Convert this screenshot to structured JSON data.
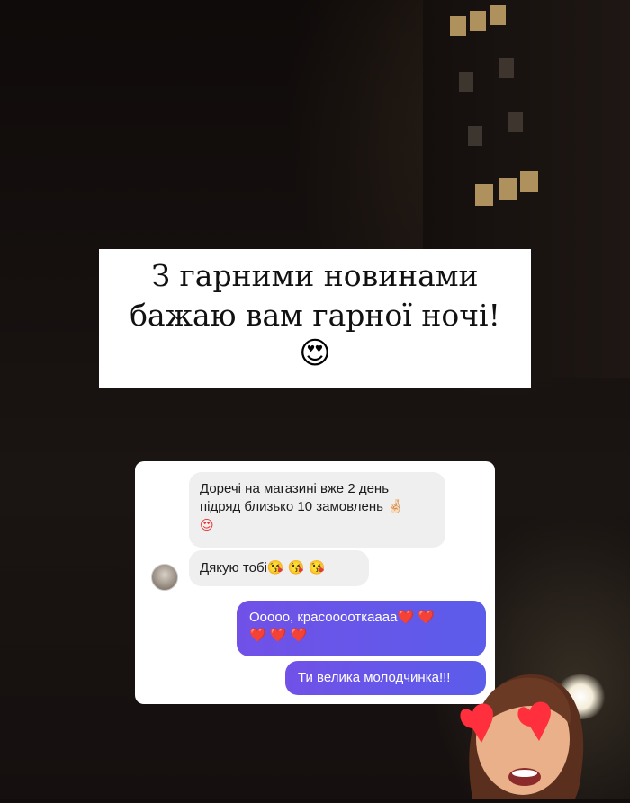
{
  "headline": {
    "line1": "З гарними новинами",
    "line2": "бажаю вам гарної ночі!",
    "emoji": "😍"
  },
  "chat": {
    "messages": [
      {
        "side": "in",
        "line1": "Доречі на магазині вже 2 день",
        "line2": "підряд близько 10 замовлень 🤞🏻",
        "line3": "😍"
      },
      {
        "side": "in",
        "text": "Дякую тобі😘 😘 😘"
      },
      {
        "side": "out",
        "line1": "Ооооо, красооооткааaа❤️ ❤️",
        "line2": "❤️ ❤️ ❤️"
      },
      {
        "side": "out",
        "text": "Ти велика молодчинка!!!"
      }
    ]
  },
  "sticker": {
    "icon": "heart-eyes-memoji-icon"
  }
}
